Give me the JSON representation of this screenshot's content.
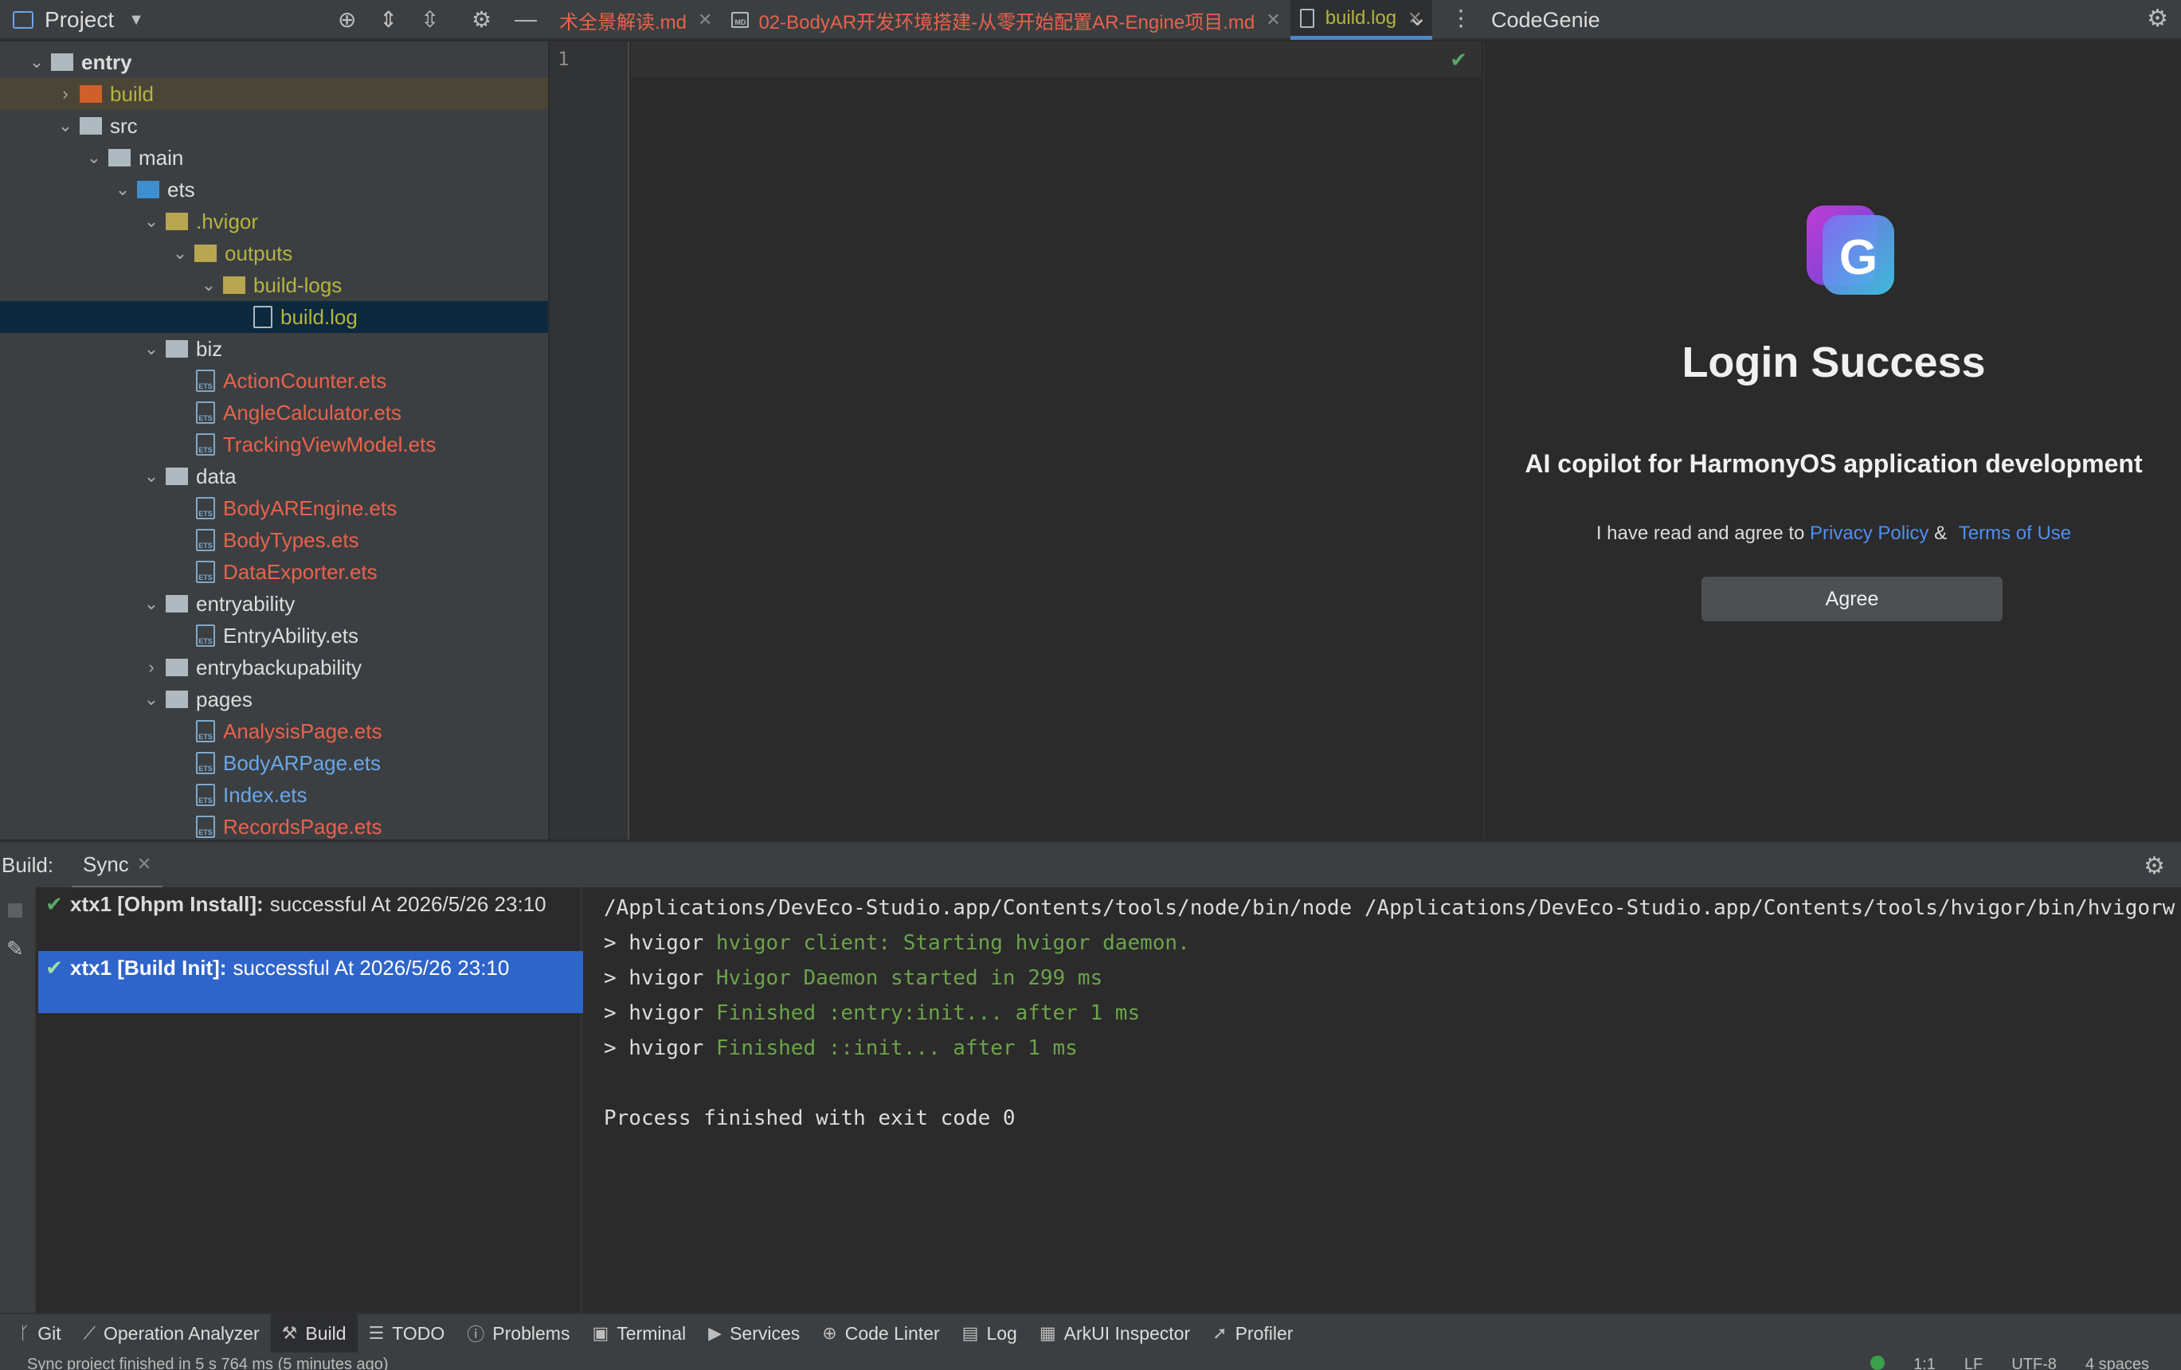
{
  "project_panel": {
    "title": "Project"
  },
  "tabs": [
    {
      "label": "术全景解读.md",
      "style": "red"
    },
    {
      "label": "02-BodyAR开发环境搭建-从零开始配置AR-Engine项目.md",
      "style": "red",
      "file_badge": "MD"
    },
    {
      "label": "build.log",
      "style": "active"
    }
  ],
  "codegenie": {
    "title": "CodeGenie",
    "logo_letter": "G",
    "heading": "Login Success",
    "subtitle": "AI copilot for HarmonyOS application development",
    "agree_prefix": "I have read and agree to",
    "privacy_link": "Privacy Policy",
    "amp": "&",
    "terms_link": "Terms of Use",
    "agree_button": "Agree"
  },
  "tree": [
    {
      "label": "entry",
      "indent": 0,
      "chev": "open",
      "icon": "folder-grey-module",
      "style": "default-bold"
    },
    {
      "label": "build",
      "indent": 1,
      "chev": "closed",
      "icon": "folder-orange",
      "style": "yellow",
      "highlight": true
    },
    {
      "label": "src",
      "indent": 1,
      "chev": "open",
      "icon": "folder-grey",
      "style": "default"
    },
    {
      "label": "main",
      "indent": 2,
      "chev": "open",
      "icon": "folder-grey",
      "style": "default"
    },
    {
      "label": "ets",
      "indent": 3,
      "chev": "open",
      "icon": "folder-blue",
      "style": "default"
    },
    {
      "label": ".hvigor",
      "indent": 4,
      "chev": "open",
      "icon": "folder-yellow",
      "style": "yellow"
    },
    {
      "label": "outputs",
      "indent": 5,
      "chev": "open",
      "icon": "folder-yellow",
      "style": "yellow"
    },
    {
      "label": "build-logs",
      "indent": 6,
      "chev": "open",
      "icon": "folder-yellow",
      "style": "yellow"
    },
    {
      "label": "build.log",
      "indent": 7,
      "chev": "none",
      "icon": "file-log",
      "style": "yellow",
      "selected": true
    },
    {
      "label": "biz",
      "indent": 4,
      "chev": "open",
      "icon": "folder-grey",
      "style": "default"
    },
    {
      "label": "ActionCounter.ets",
      "indent": 5,
      "chev": "none",
      "icon": "file-ets",
      "style": "red"
    },
    {
      "label": "AngleCalculator.ets",
      "indent": 5,
      "chev": "none",
      "icon": "file-ets",
      "style": "red"
    },
    {
      "label": "TrackingViewModel.ets",
      "indent": 5,
      "chev": "none",
      "icon": "file-ets",
      "style": "red"
    },
    {
      "label": "data",
      "indent": 4,
      "chev": "open",
      "icon": "folder-grey",
      "style": "default"
    },
    {
      "label": "BodyAREngine.ets",
      "indent": 5,
      "chev": "none",
      "icon": "file-ets",
      "style": "red"
    },
    {
      "label": "BodyTypes.ets",
      "indent": 5,
      "chev": "none",
      "icon": "file-ets",
      "style": "red"
    },
    {
      "label": "DataExporter.ets",
      "indent": 5,
      "chev": "none",
      "icon": "file-ets",
      "style": "red"
    },
    {
      "label": "entryability",
      "indent": 4,
      "chev": "open",
      "icon": "folder-grey",
      "style": "default"
    },
    {
      "label": "EntryAbility.ets",
      "indent": 5,
      "chev": "none",
      "icon": "file-ets",
      "style": "default"
    },
    {
      "label": "entrybackupability",
      "indent": 4,
      "chev": "closed",
      "icon": "folder-grey",
      "style": "default"
    },
    {
      "label": "pages",
      "indent": 4,
      "chev": "open",
      "icon": "folder-grey",
      "style": "default"
    },
    {
      "label": "AnalysisPage.ets",
      "indent": 5,
      "chev": "none",
      "icon": "file-ets",
      "style": "red"
    },
    {
      "label": "BodyARPage.ets",
      "indent": 5,
      "chev": "none",
      "icon": "file-ets",
      "style": "blue"
    },
    {
      "label": "Index.ets",
      "indent": 5,
      "chev": "none",
      "icon": "file-ets",
      "style": "blue"
    },
    {
      "label": "RecordsPage.ets",
      "indent": 5,
      "chev": "none",
      "icon": "file-ets",
      "style": "red"
    }
  ],
  "editor": {
    "line_numbers": [
      "1"
    ]
  },
  "build_panel": {
    "label": "Build:",
    "tab": "Sync",
    "entries": [
      {
        "name": "xtx1 [Ohpm Install]:",
        "status": "successful At 2026/5/26 23:10",
        "selected": false
      },
      {
        "name": "xtx1 [Build Init]:",
        "status": "successful At 2026/5/26 23:10",
        "selected": true
      }
    ],
    "console": [
      {
        "text": "/Applications/DevEco-Studio.app/Contents/tools/node/bin/node /Applications/DevEco-Studio.app/Contents/tools/hvigor/bin/hvigorw"
      },
      {
        "prefix": "> hvigor ",
        "text": "hvigor client: Starting hvigor daemon.",
        "green": true
      },
      {
        "prefix": "> hvigor ",
        "text": "Hvigor Daemon started in 299 ms",
        "green": true
      },
      {
        "prefix": "> hvigor ",
        "text": "Finished :entry:init... after 1 ms",
        "green": true
      },
      {
        "prefix": "> hvigor ",
        "text": "Finished ::init... after 1 ms",
        "green": true
      },
      {
        "text": ""
      },
      {
        "text": "Process finished with exit code 0"
      }
    ]
  },
  "bottom_tools": [
    {
      "label": "Git",
      "icon": "git-branch-icon",
      "glyph": "ᚴ"
    },
    {
      "label": "Operation Analyzer",
      "icon": "chart-icon",
      "glyph": "⟋"
    },
    {
      "label": "Build",
      "icon": "hammer-icon",
      "glyph": "⚒",
      "active": true
    },
    {
      "label": "TODO",
      "icon": "list-icon",
      "glyph": "☰"
    },
    {
      "label": "Problems",
      "icon": "info-icon",
      "glyph": "ⓘ"
    },
    {
      "label": "Terminal",
      "icon": "terminal-icon",
      "glyph": "▣"
    },
    {
      "label": "Services",
      "icon": "play-icon",
      "glyph": "▶"
    },
    {
      "label": "Code Linter",
      "icon": "linter-icon",
      "glyph": "⊕"
    },
    {
      "label": "Log",
      "icon": "log-icon",
      "glyph": "▤"
    },
    {
      "label": "ArkUI Inspector",
      "icon": "inspector-icon",
      "glyph": "▦"
    },
    {
      "label": "Profiler",
      "icon": "profiler-icon",
      "glyph": "➚"
    }
  ],
  "status_bar": {
    "message": "Sync project finished in 5 s 764 ms (5 minutes ago)",
    "position": "1:1",
    "line_ending": "LF",
    "encoding": "UTF-8",
    "indent": "4 spaces"
  }
}
